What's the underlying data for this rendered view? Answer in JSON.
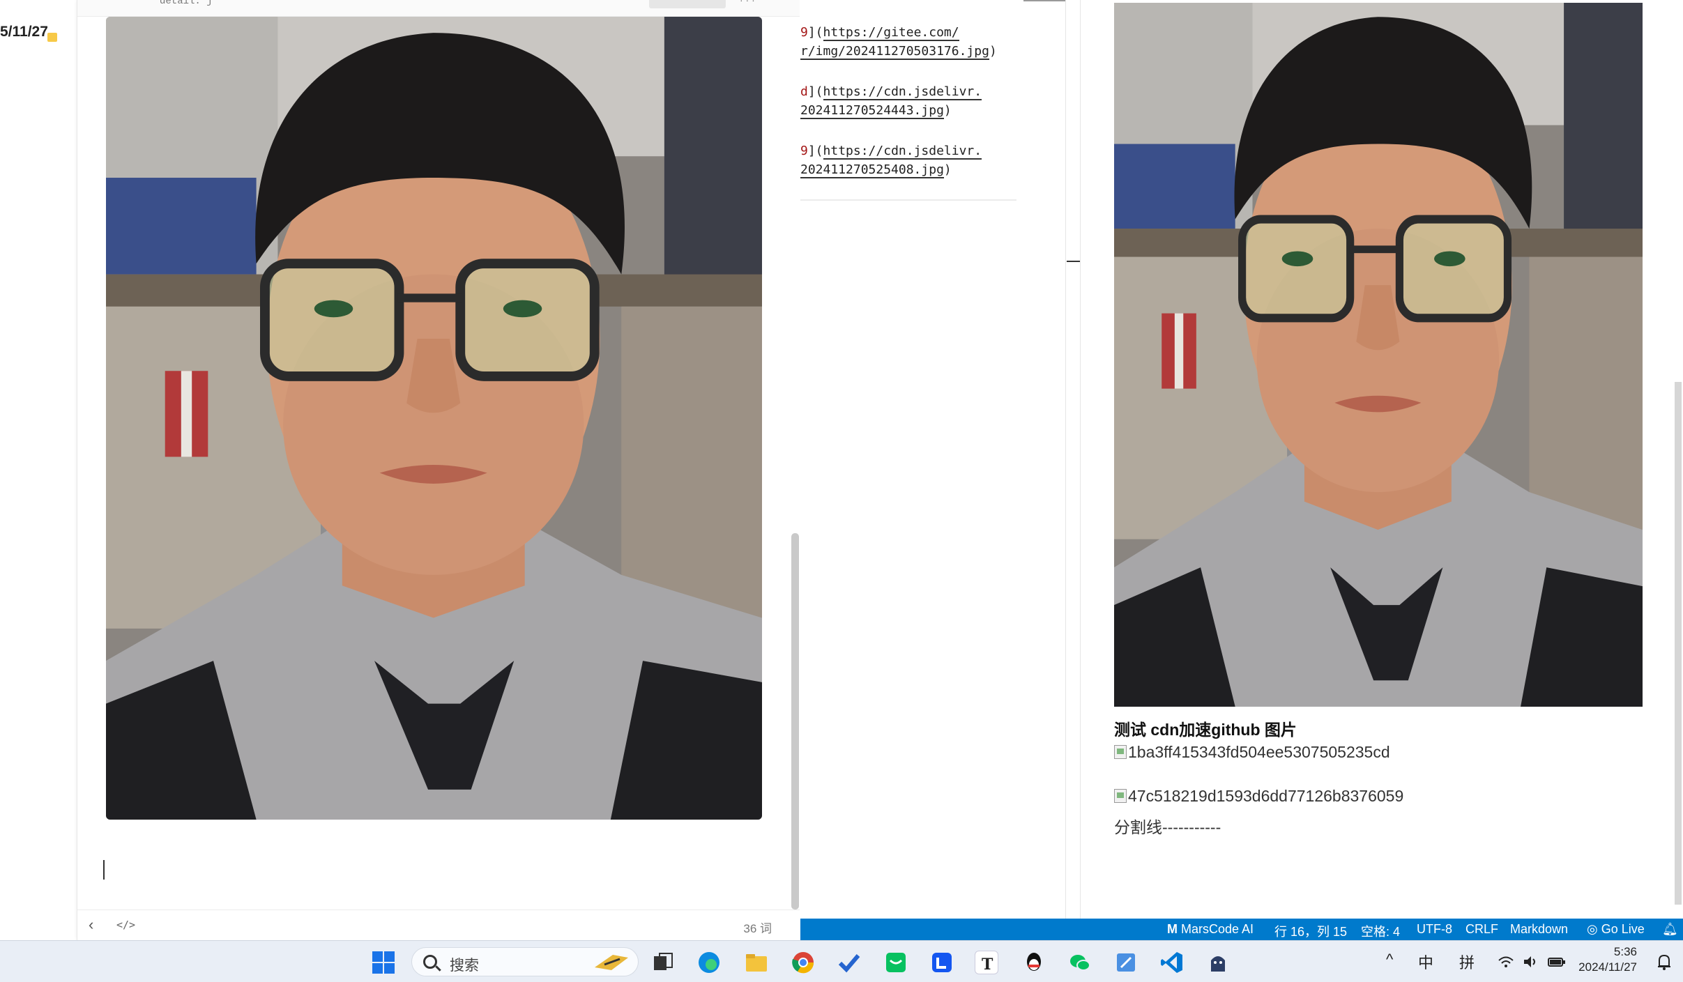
{
  "left_strip": {
    "date_fragment": "5/11/27"
  },
  "editor": {
    "top_fragment": "detail. j",
    "word_count": "36 词",
    "footer_back": "‹",
    "footer_source": "</>"
  },
  "code": {
    "lines": [
      {
        "prefix": "9",
        "rest": "](",
        "url": "https://gitee.com/"
      },
      {
        "prefix": "",
        "rest": "",
        "url": "r/img/202411270503176.jpg",
        "tail": ")"
      },
      {
        "prefix": "d",
        "rest": "](",
        "url": "https://cdn.jsdelivr."
      },
      {
        "prefix": "",
        "rest": "",
        "url": "202411270524443.jpg",
        "tail": ")"
      },
      {
        "prefix": "9",
        "rest": "](",
        "url": "https://cdn.jsdelivr."
      },
      {
        "prefix": "",
        "rest": "",
        "url": "202411270525408.jpg",
        "tail": ")"
      }
    ]
  },
  "preview": {
    "heading": "测试 cdn加速github 图片",
    "broken_images": [
      "1ba3ff415343fd504ee5307505235cd",
      "47c518219d1593d6dd77126b8376059"
    ],
    "divider_text": "分割线-----------"
  },
  "statusbar": {
    "marscode": "MarsCode AI",
    "position": "行 16，列 15",
    "spaces": "空格: 4",
    "encoding": "UTF-8",
    "eol": "CRLF",
    "language": "Markdown",
    "golive": "Go Live"
  },
  "taskbar": {
    "search_placeholder": "搜索",
    "ime_lang": "中",
    "ime_mode": "拼",
    "time": "5:36",
    "date": "2024/11/27",
    "chevron": "^",
    "apps": [
      "start-icon",
      "task-view-icon",
      "edge-icon",
      "file-explorer-icon",
      "chrome-icon",
      "todo-icon",
      "wechat-work-icon",
      "lark-icon",
      "typora-icon",
      "qq-icon",
      "wechat-icon",
      "notepad-icon",
      "vscode-icon",
      "ghost-icon"
    ]
  },
  "colors": {
    "statusbar": "#007acc",
    "taskbar": "#e9eef6",
    "link_red": "#a31515"
  }
}
